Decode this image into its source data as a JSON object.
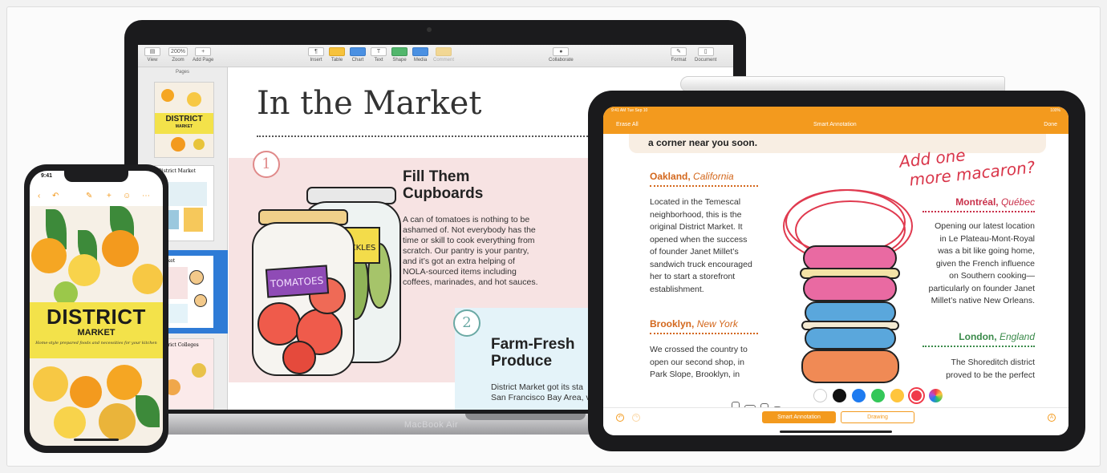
{
  "macbook": {
    "label": "MacBook Air",
    "toolbar": {
      "view": "View",
      "zoom_value": "200%",
      "zoom": "Zoom",
      "add_page": "Add Page",
      "insert": "Insert",
      "table": "Table",
      "chart": "Chart",
      "text": "Text",
      "shape": "Shape",
      "media": "Media",
      "comment": "Comment",
      "collaborate": "Collaborate",
      "format": "Format",
      "document": "Document"
    },
    "pages_panel": {
      "title": "Pages",
      "thumb1_title": "DISTRICT",
      "thumb1_sub": "MARKET",
      "thumb2_title": "District Market",
      "thumb3_title": "Market",
      "thumb4_title": "District Colleges"
    },
    "document": {
      "title": "In the Market",
      "section1_number": "1",
      "section1_heading_line1": "Fill Them",
      "section1_heading_line2": "Cupboards",
      "section1_body": [
        "A can of tomatoes is nothing to be",
        "ashamed of. Not everybody has the",
        "time or skill to cook everything from",
        "scratch. Our pantry is your pantry,",
        "and it’s got an extra helping of",
        "NOLA-sourced items including",
        "coffees, marinades, and hot sauces."
      ],
      "jar1_label": "TOMATOES",
      "jar2_label": "PICKLES",
      "section2_number": "2",
      "section2_heading_line1": "Farm-Fresh",
      "section2_heading_line2": "Produce",
      "section2_body": [
        "District Market got its sta",
        "San Francisco Bay Area, v"
      ]
    }
  },
  "ipad": {
    "status_time": "9:41 AM   Tue Sep 10",
    "status_battery": "100%",
    "erase_all": "Erase All",
    "title": "Smart Annotation",
    "done": "Done",
    "top_line": "a corner near you soon.",
    "handwriting": [
      "Add one",
      "more macaron?"
    ],
    "oakland": {
      "city": "Oakland,",
      "region": "California"
    },
    "oakland_body": [
      "Located in the Temescal",
      "neighborhood, this is the",
      "original District Market. It",
      "opened when the success",
      "of founder Janet Millet’s",
      "sandwich truck encouraged",
      "her to start a storefront",
      "establishment."
    ],
    "brooklyn": {
      "city": "Brooklyn,",
      "region": "New York"
    },
    "brooklyn_body": [
      "We crossed the country to",
      "open our second shop, in",
      "Park Slope, Brooklyn, in"
    ],
    "montreal": {
      "city": "Montréal,",
      "region": "Québec"
    },
    "montreal_body": [
      "Opening our latest location",
      "in Le Plateau-Mont-Royal",
      "was a bit like going home,",
      "given the French influence",
      "on Southern cooking—",
      "particularly on founder Janet",
      "Millet’s native New Orleans."
    ],
    "london": {
      "city": "London,",
      "region": "England"
    },
    "london_body": [
      "The Shoreditch district",
      "proved to be the perfect"
    ],
    "swatches": [
      "#ffffff",
      "#111111",
      "#1e7bf0",
      "#34c759",
      "#ffc53d",
      "#f03a4a"
    ],
    "segment_smart": "Smart Annotation",
    "segment_drawing": "Drawing"
  },
  "iphone": {
    "status_time": "9:41",
    "cover_title": "DISTRICT",
    "cover_sub": "MARKET",
    "cover_tagline": "Home-style prepared foods and necessities for your kitchen"
  }
}
